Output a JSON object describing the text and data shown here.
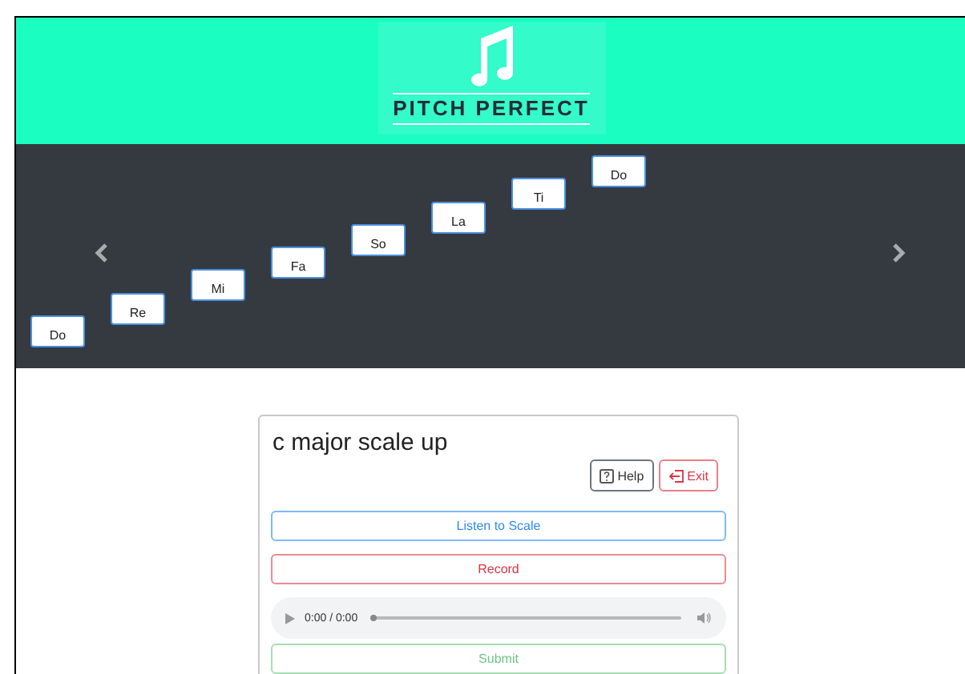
{
  "header": {
    "logo_text": "PITCH PERFECT"
  },
  "scale": {
    "notes": [
      {
        "label": "Do"
      },
      {
        "label": "Re"
      },
      {
        "label": "Mi"
      },
      {
        "label": "Fa"
      },
      {
        "label": "So"
      },
      {
        "label": "La"
      },
      {
        "label": "Ti"
      },
      {
        "label": "Do"
      }
    ]
  },
  "card": {
    "title": "c major scale up",
    "actions": [
      {
        "label": "Help",
        "kind": "help"
      },
      {
        "label": "Exit",
        "kind": "exit"
      }
    ],
    "buttons": [
      {
        "label": "Listen to Scale",
        "kind": "primary"
      },
      {
        "label": "Record",
        "kind": "danger"
      }
    ],
    "player": {
      "time": "0:00 / 0:00",
      "level": 0
    },
    "submit": {
      "label": "Submit"
    }
  }
}
